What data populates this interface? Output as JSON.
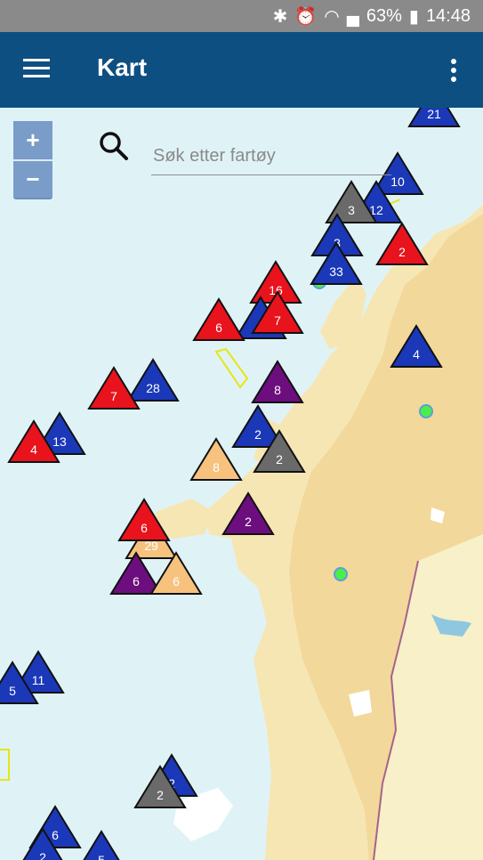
{
  "status": {
    "battery": "63%",
    "time": "14:48"
  },
  "app": {
    "title": "Kart"
  },
  "search": {
    "placeholder": "Søk etter fartøy"
  },
  "zoom": {
    "in_label": "+",
    "out_label": "−"
  },
  "colors": {
    "red": "#e8131c",
    "blue": "#1b38b8",
    "gray": "#6a6a6a",
    "purple": "#6c0e7d",
    "orange": "#f7c27e",
    "appbar": "#0e4f82",
    "land": "#f6e6b3",
    "sea": "#dff3f7"
  },
  "markers": [
    {
      "label": "21",
      "color": "blue"
    },
    {
      "label": "10",
      "color": "blue"
    },
    {
      "label": "12",
      "color": "blue"
    },
    {
      "label": "3",
      "color": "gray"
    },
    {
      "label": "2",
      "color": "red"
    },
    {
      "label": "3",
      "color": "blue"
    },
    {
      "label": "33",
      "color": "blue"
    },
    {
      "label": "16",
      "color": "red"
    },
    {
      "label": "5",
      "color": "blue"
    },
    {
      "label": "7",
      "color": "red"
    },
    {
      "label": "6",
      "color": "red"
    },
    {
      "label": "4",
      "color": "blue"
    },
    {
      "label": "28",
      "color": "blue"
    },
    {
      "label": "7",
      "color": "red"
    },
    {
      "label": "8",
      "color": "purple"
    },
    {
      "label": "13",
      "color": "blue"
    },
    {
      "label": "4",
      "color": "red"
    },
    {
      "label": "2",
      "color": "blue"
    },
    {
      "label": "2",
      "color": "gray"
    },
    {
      "label": "8",
      "color": "orange"
    },
    {
      "label": "2",
      "color": "purple"
    },
    {
      "label": "29",
      "color": "orange"
    },
    {
      "label": "6",
      "color": "red"
    },
    {
      "label": "6",
      "color": "purple"
    },
    {
      "label": "6",
      "color": "orange"
    },
    {
      "label": "11",
      "color": "blue"
    },
    {
      "label": "5",
      "color": "blue"
    },
    {
      "label": "2",
      "color": "blue"
    },
    {
      "label": "2",
      "color": "gray"
    },
    {
      "label": "6",
      "color": "blue"
    },
    {
      "label": "2",
      "color": "blue"
    },
    {
      "label": "5",
      "color": "blue"
    }
  ]
}
